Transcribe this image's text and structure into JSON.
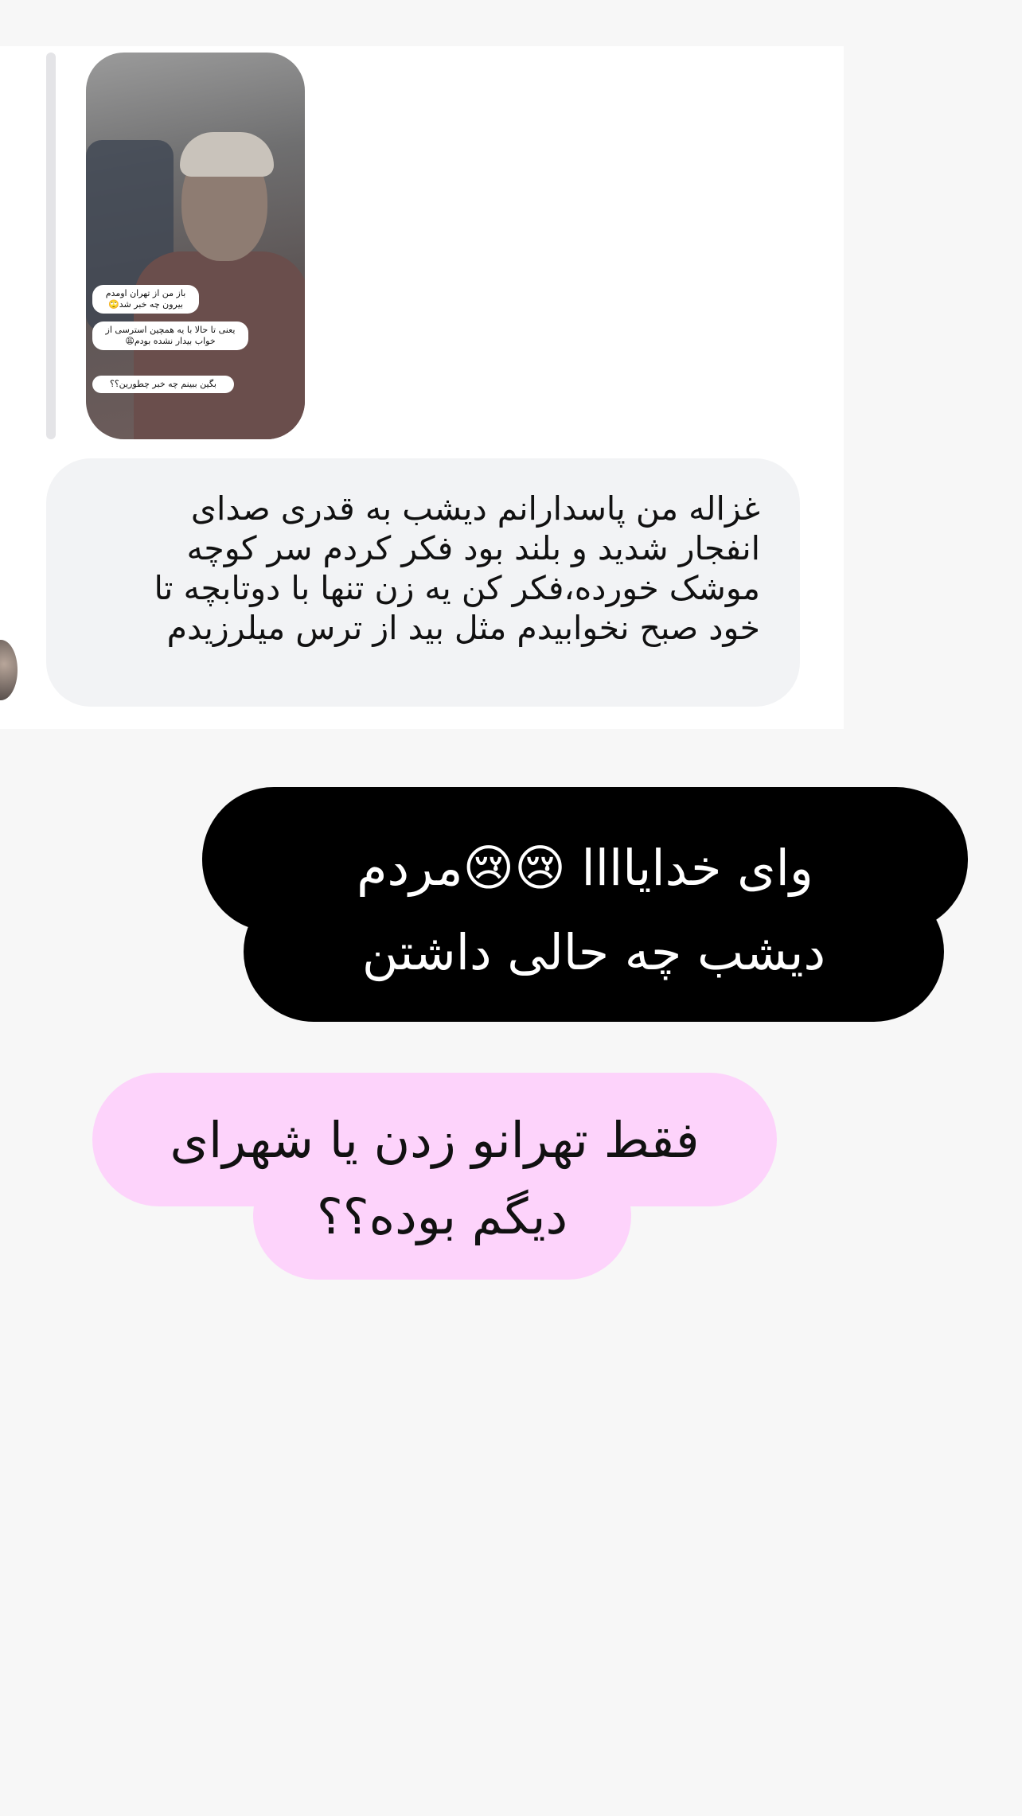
{
  "story_reply": {
    "sticker_1": "باز من از تهران اومدم بیرون چه خبر شد🙄",
    "sticker_2": "یعنی تا حالا با یه همچین استرسی از خواب بیدار نشده بودم😩",
    "sticker_3": "بگین ببینم چه خبر چطورین؟؟"
  },
  "messages": {
    "incoming": "غزاله من پاسدارانم دیشب به قدری صدای\nانفجار شدید و بلند بود فکر کردم سر کوچه\nموشک خورده،فکر کن یه زن تنها با دوتابچه  تا\nخود صبح نخوابیدم مثل بید از ترس میلرزیدم",
    "black_line_1": "وای خدایاااا 😢😢مردم",
    "black_line_2": "دیشب چه حالی داشتن",
    "pink_line_1": "فقط تهرانو زدن یا شهرای",
    "pink_line_2": "دیگم بوده؟؟"
  },
  "colors": {
    "black_bubble": "#000000",
    "pink_bubble": "#fdd3fb",
    "incoming_bubble": "#f2f3f5"
  }
}
